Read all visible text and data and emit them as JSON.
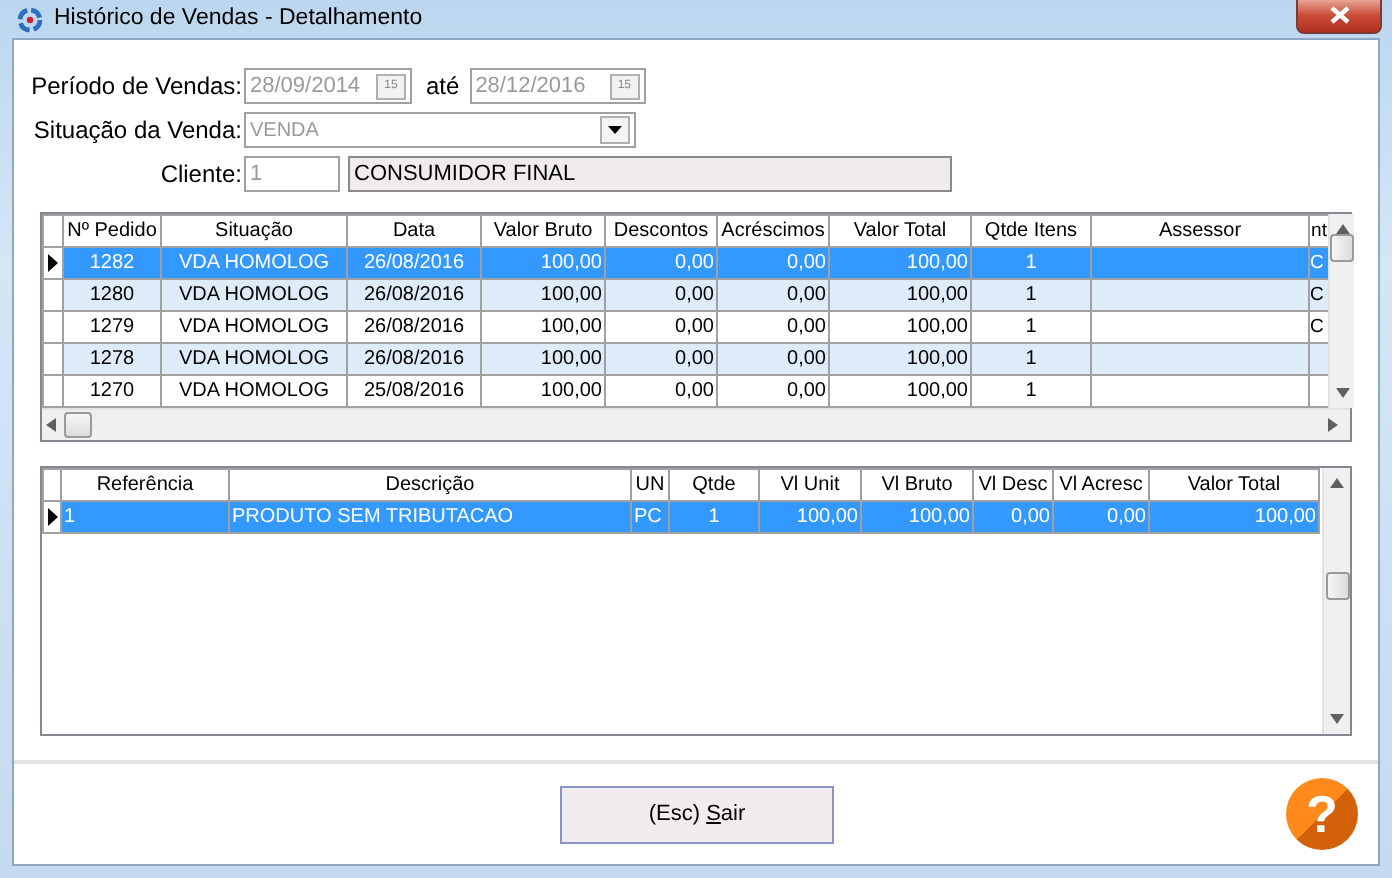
{
  "window": {
    "title": "Histórico de Vendas - Detalhamento"
  },
  "filters": {
    "period": {
      "label": "Período de Vendas:",
      "from": {
        "value": "28/09/2014",
        "button_text": "15",
        "disabled": true
      },
      "separator": "até",
      "to": {
        "value": "28/12/2016",
        "button_text": "15",
        "disabled": true
      }
    },
    "status": {
      "label": "Situação da Venda:",
      "value": "VENDA",
      "disabled": true
    },
    "client": {
      "label": "Cliente:",
      "code": "1",
      "code_disabled": true,
      "name": "CONSUMIDOR FINAL",
      "name_readonly": true
    }
  },
  "orders": {
    "columns": [
      "Nº Pedido",
      "Situação",
      "Data",
      "Valor Bruto",
      "Descontos",
      "Acréscimos",
      "Valor Total",
      "Qtde Itens",
      "Assessor",
      "nt"
    ],
    "rows": [
      {
        "selected": true,
        "cells": [
          "1282",
          "VDA HOMOLOG",
          "26/08/2016",
          "100,00",
          "0,00",
          "0,00",
          "100,00",
          "1"
        ],
        "column_11": "C"
      },
      {
        "selected": false,
        "cells": [
          "1280",
          "VDA HOMOLOG",
          "26/08/2016",
          "100,00",
          "0,00",
          "0,00",
          "100,00",
          "1"
        ],
        "column_11": "C"
      },
      {
        "selected": false,
        "cells": [
          "1279",
          "VDA HOMOLOG",
          "26/08/2016",
          "100,00",
          "0,00",
          "0,00",
          "100,00",
          "1"
        ],
        "column_11": "C"
      },
      {
        "selected": false,
        "cells": [
          "1278",
          "VDA HOMOLOG",
          "26/08/2016",
          "100,00",
          "0,00",
          "0,00",
          "100,00",
          "1"
        ]
      },
      {
        "selected": false,
        "cells": [
          "1270",
          "VDA HOMOLOG",
          "25/08/2016",
          "100,00",
          "0,00",
          "0,00",
          "100,00",
          "1"
        ]
      }
    ]
  },
  "items": {
    "columns": [
      "Referência",
      "Descrição",
      "UN",
      "Qtde",
      "Vl Unit",
      "Vl Bruto",
      "Vl Desc",
      "Vl Acresc",
      "Valor Total"
    ],
    "rows": [
      {
        "selected": true,
        "cells": [
          "1",
          "PRODUTO SEM TRIBUTACAO",
          "PC",
          "1",
          "100,00",
          "100,00",
          "0,00",
          "0,00",
          "100,00"
        ]
      }
    ]
  },
  "exit_button": {
    "label": "(Esc) Sair",
    "mnemonic_underlined": true
  },
  "help_button": {
    "label": "?"
  }
}
